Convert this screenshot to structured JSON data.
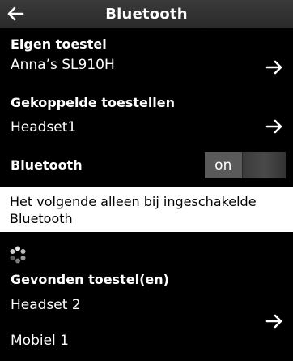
{
  "header": {
    "title": "Bluetooth",
    "back_icon": "arrow-left-icon"
  },
  "own_device": {
    "label": "Eigen toestel",
    "value": "Anna’s SL910H"
  },
  "paired_devices": {
    "label": "Gekoppelde toestellen",
    "value": "Headset1"
  },
  "bluetooth": {
    "label": "Bluetooth",
    "toggle_state": "on"
  },
  "note": {
    "text": "Het volgende alleen bij ingeschakelde Bluetooth"
  },
  "found_devices": {
    "label": "Gevonden toestel(en)",
    "items": [
      "Headset 2",
      "Mobiel 1"
    ]
  },
  "colors": {
    "background": "#000000",
    "header": "#333333",
    "toggle": "#5a5a5a",
    "note_bg": "#ffffff"
  }
}
